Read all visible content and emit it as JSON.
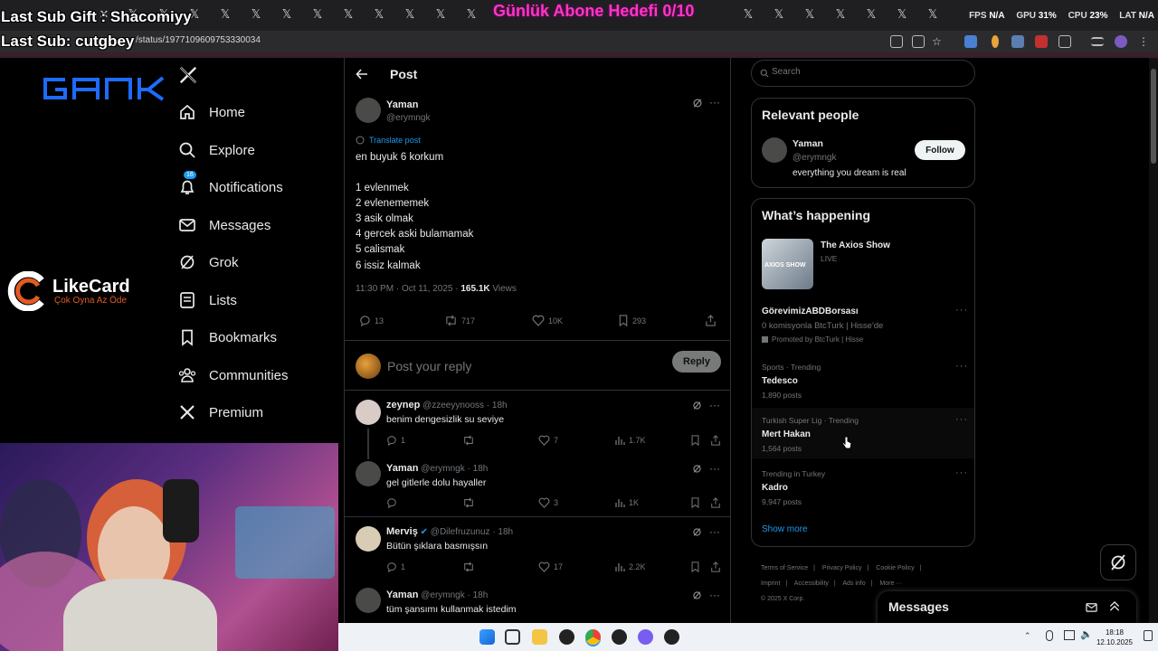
{
  "overlay": {
    "gift": "Last Sub Gift : Shacomiyy",
    "last_sub": "Last Sub: cutgbey",
    "goal": "Günlük Abone Hedefi 0/10",
    "fps_label": "FPS",
    "fps_value": "N/A",
    "gpu_label": "GPU",
    "gpu_value": "31%",
    "cpu_label": "CPU",
    "cpu_value": "23%",
    "lat_label": "LAT",
    "lat_value": "N/A"
  },
  "browser": {
    "url": "/status/1977109609753330034"
  },
  "left": {
    "brand": "GANK",
    "sponsor_name": "LikeCard",
    "sponsor_slogan": "Çok Oyna Az Öde",
    "nav": [
      {
        "label": "Home"
      },
      {
        "label": "Explore"
      },
      {
        "label": "Notifications",
        "badge": "16"
      },
      {
        "label": "Messages"
      },
      {
        "label": "Grok"
      },
      {
        "label": "Lists"
      },
      {
        "label": "Bookmarks"
      },
      {
        "label": "Communities"
      },
      {
        "label": "Premium"
      }
    ]
  },
  "post": {
    "header_title": "Post",
    "author_name": "Yaman",
    "author_handle": "@erymngk",
    "translate": "Translate post",
    "lines": [
      "en buyuk 6 korkum",
      "",
      "1 evlenmek",
      "2 evlenememek",
      "3 asik olmak",
      "4 gercek aski bulamamak",
      "5 calismak",
      "6 issiz kalmak"
    ],
    "time": "11:30 PM · Oct 11, 2025 · ",
    "views_count": "165.1K",
    "views_label": " Views",
    "replies": "13",
    "reposts": "717",
    "likes": "10K",
    "bookmarks": "293",
    "reply_placeholder": "Post your reply",
    "reply_button": "Reply"
  },
  "replies": [
    {
      "name": "zeynep",
      "meta": " @zzeeyynooss · 18h",
      "text": "benim dengesizlik su seviye",
      "replies": "1",
      "likes": "7",
      "views": "1.7K"
    },
    {
      "name": "Yaman",
      "meta": " @erymngk · 18h",
      "text": "gel gitlerle dolu hayaller",
      "replies": "",
      "likes": "3",
      "views": "1K"
    },
    {
      "name": "Merviş",
      "meta": " @Dilefruzunuz · 18h",
      "text": "Bütün şıklara basmışsın",
      "replies": "1",
      "likes": "17",
      "views": "2.2K"
    },
    {
      "name": "Yaman",
      "meta": " @erymngk · 18h",
      "text": "tüm şansımı kullanmak istedim"
    }
  ],
  "right": {
    "search_placeholder": "Search",
    "relevant_title": "Relevant people",
    "person_name": "Yaman",
    "person_handle": "@erymngk",
    "person_bio": "everything you dream is real",
    "follow": "Follow",
    "happening_title": "What’s happening",
    "live_show": "The Axios Show",
    "live_label": "LIVE",
    "live_thumb_text": "AXIOS SHOW",
    "promo_name": "GörevimizABDBorsası",
    "promo_desc": "0 komisyonla BtcTurk | Hisse'de",
    "promo_by": "Promoted by BtcTurk | Hisse",
    "trends": [
      {
        "context": "Sports · Trending",
        "name": "Tedesco",
        "posts": "1,890 posts"
      },
      {
        "context": "Turkish Super Lig · Trending",
        "name": "Mert Hakan",
        "posts": "1,564 posts"
      },
      {
        "context": "Trending in Turkey",
        "name": "Kadro",
        "posts": "9,947 posts"
      }
    ],
    "show_more": "Show more",
    "footer": [
      "Terms of Service",
      "|",
      "Privacy Policy",
      "|",
      "Cookie Policy",
      "|",
      "Imprint",
      "|",
      "Accessibility",
      "|",
      "Ads info",
      "|",
      "More ···",
      "© 2025 X Corp."
    ],
    "messages_title": "Messages"
  },
  "taskbar": {
    "time": "18:18",
    "date": "12.10.2025"
  },
  "colors": {
    "accent": "#1d9bf0",
    "goal": "#ff35c8",
    "brand_gank": "#1f6bff",
    "sponsor": "#e35a22"
  }
}
